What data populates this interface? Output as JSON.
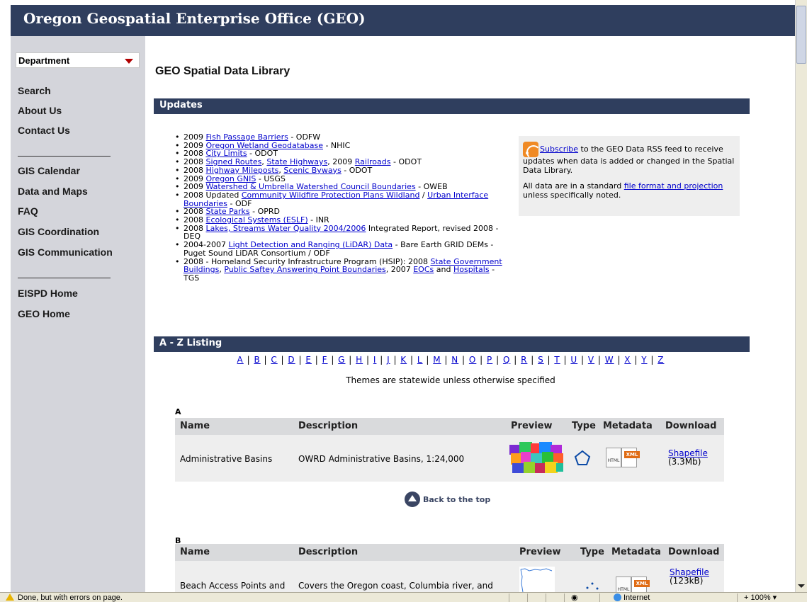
{
  "header": {
    "title": "Oregon Geospatial Enterprise Office (GEO)"
  },
  "sidebar": {
    "dropdown": {
      "selected": "Department"
    },
    "group1": [
      "Search",
      "About Us",
      "Contact Us"
    ],
    "group2": [
      "GIS Calendar",
      "Data and Maps",
      "FAQ",
      "GIS Coordination",
      "GIS Communication"
    ],
    "group3": [
      "EISPD Home",
      "GEO Home"
    ]
  },
  "page": {
    "title": "GEO Spatial Data Library"
  },
  "updates": {
    "heading": "Updates",
    "items": [
      [
        {
          "t": "2009 "
        },
        {
          "l": "Fish Passage Barriers"
        },
        {
          "t": " - ODFW"
        }
      ],
      [
        {
          "t": "2009 "
        },
        {
          "l": "Oregon Wetland Geodatabase"
        },
        {
          "t": " - NHIC"
        }
      ],
      [
        {
          "t": "2008 "
        },
        {
          "l": "City Limits"
        },
        {
          "t": " - ODOT"
        }
      ],
      [
        {
          "t": "2008 "
        },
        {
          "l": "Signed Routes"
        },
        {
          "t": ", "
        },
        {
          "l": "State Highways"
        },
        {
          "t": ", 2009 "
        },
        {
          "l": "Railroads"
        },
        {
          "t": " - ODOT"
        }
      ],
      [
        {
          "t": "2008 "
        },
        {
          "l": "Highway Mileposts"
        },
        {
          "t": ", "
        },
        {
          "l": "Scenic Byways"
        },
        {
          "t": " - ODOT"
        }
      ],
      [
        {
          "t": "2009 "
        },
        {
          "l": "Oregon GNIS"
        },
        {
          "t": " - USGS"
        }
      ],
      [
        {
          "t": "2009 "
        },
        {
          "l": "Watershed & Umbrella Watershed Council Boundaries"
        },
        {
          "t": " - OWEB"
        }
      ],
      [
        {
          "t": "2008 Updated "
        },
        {
          "l": "Community Wildfire Protection Plans Wildland"
        },
        {
          "t": " / "
        },
        {
          "l": "Urban Interface Boundaries"
        },
        {
          "t": " - ODF"
        }
      ],
      [
        {
          "t": "2008 "
        },
        {
          "l": "State Parks"
        },
        {
          "t": " - OPRD"
        }
      ],
      [
        {
          "t": "2008 "
        },
        {
          "l": "Ecological Systems (ESLF)"
        },
        {
          "t": " - INR"
        }
      ],
      [
        {
          "t": "2008 "
        },
        {
          "l": "Lakes, Streams Water Quality 2004/2006"
        },
        {
          "t": " Integrated Report, revised 2008 - DEQ"
        }
      ],
      [
        {
          "t": "2004-2007 "
        },
        {
          "l": "Light Detection and Ranging (LiDAR) Data"
        },
        {
          "t": " - Bare Earth GRID DEMs - Puget Sound LiDAR Consortium  / ODF"
        }
      ],
      [
        {
          "t": "2008 - Homeland Security Infrastructure Program (HSIP): 2008 "
        },
        {
          "l": "State Government Buildings"
        },
        {
          "t": ", "
        },
        {
          "l": "Public Saftey Answering Point Boundaries"
        },
        {
          "t": ", 2007 "
        },
        {
          "l": "EOCs"
        },
        {
          "t": " and "
        },
        {
          "l": "Hospitals"
        },
        {
          "t": " - TGS"
        }
      ]
    ]
  },
  "rss": {
    "subscribe_link": "Subscribe",
    "text1": " to the GEO Data RSS feed to receive updates when data is added or changed in the Spatial Data Library.",
    "text2_pre": "All data are in a standard ",
    "format_link": "file format and projection",
    "text2_post": " unless specifically noted."
  },
  "az": {
    "heading": "A - Z Listing",
    "letters": [
      "A",
      "B",
      "C",
      "D",
      "E",
      "F",
      "G",
      "H",
      "I",
      "J",
      "K",
      "L",
      "M",
      "N",
      "O",
      "P",
      "Q",
      "R",
      "S",
      "T",
      "U",
      "V",
      "W",
      "X",
      "Y",
      "Z"
    ],
    "note": "Themes are statewide unless otherwise specified"
  },
  "table_headers": {
    "name": "Name",
    "description": "Description",
    "preview": "Preview",
    "type": "Type",
    "metadata": "Metadata",
    "download": "Download"
  },
  "sections": [
    {
      "letter": "A",
      "row": {
        "name": "Administrative Basins",
        "description": "OWRD Administrative Basins, 1:24,000",
        "download_link": "Shapefile",
        "size": "(3.3Mb)",
        "meta_html": "HTML",
        "meta_xml": "XML"
      }
    },
    {
      "letter": "B",
      "row": {
        "name": "Beach Access Points and",
        "description": "Covers the Oregon coast, Columbia river, and",
        "download_link": "Shapefile",
        "size": "(123kB)",
        "meta_html": "HTML",
        "meta_xml": "XML"
      }
    }
  ],
  "back_to_top": "Back to the top",
  "status": {
    "message": "Done, but with errors on page.",
    "zone": "Internet",
    "zoom": "100%"
  }
}
